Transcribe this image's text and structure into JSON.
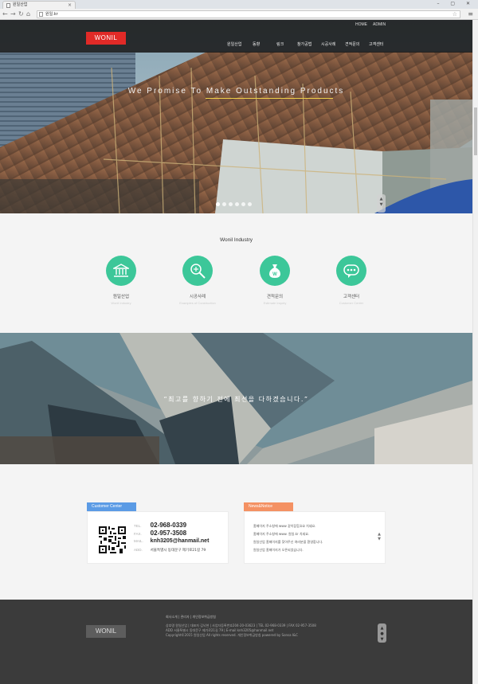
{
  "browser": {
    "tab_title": "원일산업",
    "url": "원일.kr",
    "window_controls": "– ▢ ✕",
    "close_tab": "×",
    "back_glyph": "←",
    "forward_glyph": "→",
    "reload_glyph": "↻",
    "home_glyph": "⌂",
    "star_glyph": "☆",
    "menu_glyph": "≡"
  },
  "header": {
    "logo": "WONIL",
    "util_links": [
      "HOME",
      "ADMIN"
    ],
    "menu": [
      "원일산업",
      "동향",
      "링크",
      "참가공법",
      "시공사례",
      "견적문의",
      "고객센터"
    ]
  },
  "hero": {
    "slogan": "We Promise To Make Outstanding Products",
    "slide_count": 6,
    "active_slide": 1,
    "scroll_glyph": "▲\n▼",
    "accent_color": "#f0d04a"
  },
  "services": {
    "title": "Wonil Industry",
    "accent_color": "#3cc799",
    "items": [
      {
        "label": "원일산업",
        "sub": "Wonil Industry",
        "icon": "building-icon"
      },
      {
        "label": "시공사례",
        "sub": "Examples of Construction",
        "icon": "magnifier-icon"
      },
      {
        "label": "견적문의",
        "sub": "Estimate Inquiry",
        "icon": "money-bag-icon"
      },
      {
        "label": "고객센터",
        "sub": "Customer Center",
        "icon": "chat-bubble-icon"
      }
    ]
  },
  "banner": {
    "quote": "“최고를 향하기 전에 최선을 다하겠습니다.”"
  },
  "customer_center": {
    "label": "Customer Center",
    "color": "#5b9be5",
    "tel_key": "TEL.",
    "tel": "02-968-0339",
    "fax_key": "FAX.",
    "fax": "02-957-3508",
    "mail_key": "MAIL.",
    "mail": "knh3205@hanmail.net",
    "add_key": "ADD.",
    "address": "서울특별시 동대문구 제기로21길 79"
  },
  "news": {
    "label": "News&Notice",
    "color": "#f49163",
    "items": [
      "홈페이지 주소창에 www 같이잡힘.biz 치세요.",
      "홈페이지 주소창에 www. 원일.kr 치세요.",
      "원일산업 홈페이지를 찾아주신 여러분을 환영합니다.",
      "원일산업 홈페이지가 오픈되었습니다."
    ],
    "arrows": "▲\n▼"
  },
  "footer": {
    "logo": "WONIL",
    "links": "회사소개 | 관리자 | 개인정보취급방침",
    "line1": "상호명 원일산업 | 대표자 김낙현 | 사업자등록번호204-20-03623 | TEL 02-968-0339 | FAX 02-957-3508",
    "line2": "ADD 서울특별시 동대문구 제기로21길 79 | E-mail knh3205@hanmail.net",
    "line3": "Copyright©2015 원일산업 All rights reserved. 개인정보취급방침 powered by Sonsa I&C",
    "scroll_glyph": "▲\n●\n▼"
  }
}
